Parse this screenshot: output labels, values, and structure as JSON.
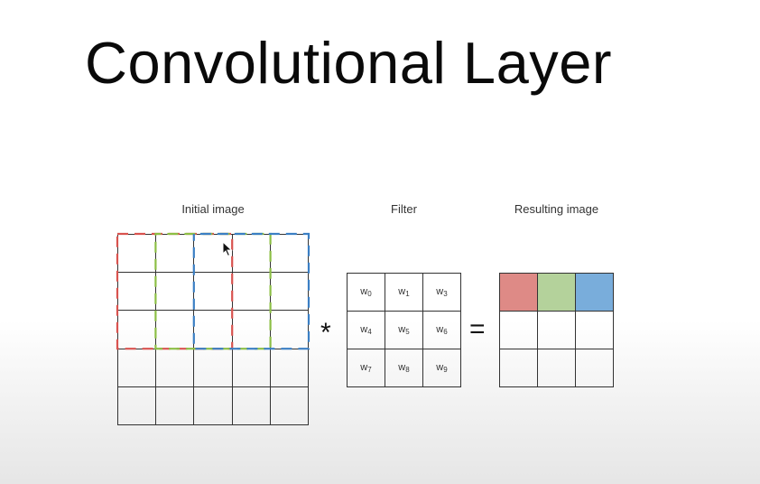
{
  "title": "Convolutional Layer",
  "captions": {
    "initial": "Initial image",
    "filter": "Filter",
    "result": "Resulting image"
  },
  "initial_image": {
    "rows": 5,
    "cols": 5,
    "windows": [
      {
        "name": "red-window",
        "color": "#d9534f",
        "col_start": 0,
        "row_start": 0,
        "size": 3
      },
      {
        "name": "green-window",
        "color": "#8cbf45",
        "col_start": 1,
        "row_start": 0,
        "size": 3
      },
      {
        "name": "blue-window",
        "color": "#3b7fc4",
        "col_start": 2,
        "row_start": 0,
        "size": 3
      }
    ]
  },
  "filter": {
    "weights": [
      {
        "base": "w",
        "sub": "0"
      },
      {
        "base": "w",
        "sub": "1"
      },
      {
        "base": "w",
        "sub": "3"
      },
      {
        "base": "w",
        "sub": "4"
      },
      {
        "base": "w",
        "sub": "5"
      },
      {
        "base": "w",
        "sub": "6"
      },
      {
        "base": "w",
        "sub": "7"
      },
      {
        "base": "w",
        "sub": "8"
      },
      {
        "base": "w",
        "sub": "9"
      }
    ]
  },
  "operators": {
    "convolve": "*",
    "equals": "="
  },
  "result_image": {
    "rows": 3,
    "cols": 3,
    "filled": [
      {
        "index": 0,
        "color": "#de8a86"
      },
      {
        "index": 1,
        "color": "#b4d29b"
      },
      {
        "index": 2,
        "color": "#79addb"
      }
    ]
  },
  "icons": {
    "cursor": "mouse-pointer-icon"
  }
}
